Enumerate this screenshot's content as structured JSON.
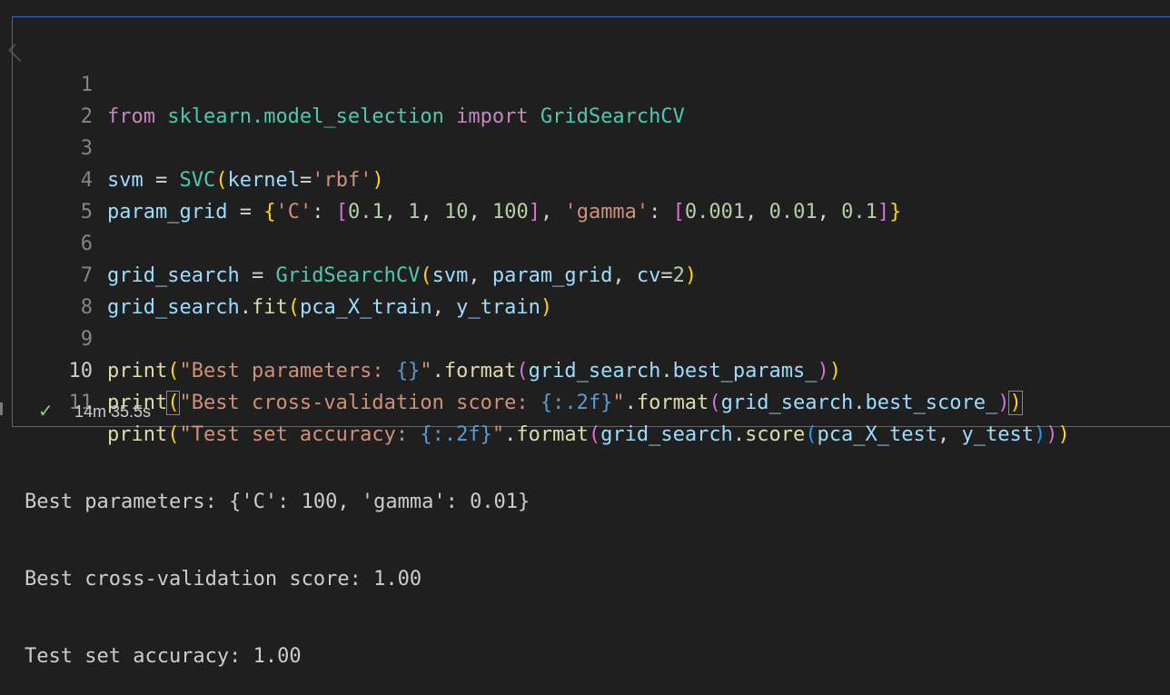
{
  "cell": {
    "lines": [
      {
        "n": "1"
      },
      {
        "n": "2"
      },
      {
        "n": "3"
      },
      {
        "n": "4"
      },
      {
        "n": "5"
      },
      {
        "n": "6"
      },
      {
        "n": "7"
      },
      {
        "n": "8"
      },
      {
        "n": "9"
      },
      {
        "n": "10"
      },
      {
        "n": "11"
      }
    ],
    "code": {
      "l1": {
        "from": "from",
        "mod": "sklearn.model_selection",
        "import": "import",
        "cls": "GridSearchCV"
      },
      "l3": {
        "var": "svm",
        "eq": " = ",
        "cls": "SVC",
        "po": "(",
        "arg": "kernel",
        "eq2": "=",
        "str": "'rbf'",
        "pc": ")"
      },
      "l4": {
        "var": "param_grid",
        "eq": " = ",
        "bo": "{",
        "k1": "'C'",
        "c1": ": ",
        "lo1": "[",
        "n1": "0.1",
        "s1": ", ",
        "n2": "1",
        "s2": ", ",
        "n3": "10",
        "s3": ", ",
        "n4": "100",
        "lc1": "]",
        "s4": ", ",
        "k2": "'gamma'",
        "c2": ": ",
        "lo2": "[",
        "n5": "0.001",
        "s5": ", ",
        "n6": "0.01",
        "s6": ", ",
        "n7": "0.1",
        "lc2": "]",
        "bc": "}"
      },
      "l6": {
        "var": "grid_search",
        "eq": " = ",
        "cls": "GridSearchCV",
        "po": "(",
        "a1": "svm",
        "s1": ", ",
        "a2": "param_grid",
        "s2": ", ",
        "a3": "cv",
        "eq2": "=",
        "n": "2",
        "pc": ")"
      },
      "l7": {
        "var": "grid_search",
        "dot": ".",
        "fn": "fit",
        "po": "(",
        "a1": "pca_X_train",
        "s1": ", ",
        "a2": "y_train",
        "pc": ")"
      },
      "l9": {
        "fn": "print",
        "po": "(",
        "str1": "\"Best parameters: ",
        "fmt": "{}",
        "str2": "\"",
        "dot": ".",
        "fmtfn": "format",
        "po2": "(",
        "a1": "grid_search",
        "dot2": ".",
        "a2": "best_params_",
        "pc2": ")",
        "pc": ")"
      },
      "l10": {
        "fn": "print",
        "po": "(",
        "str1": "\"Best cross-validation score: ",
        "fmt": "{:.2f}",
        "str2": "\"",
        "dot": ".",
        "fmtfn": "format",
        "po2": "(",
        "a1": "grid_search",
        "dot2": ".",
        "a2": "best_score_",
        "pc2": ")",
        "pc": ")"
      },
      "l11": {
        "fn": "print",
        "po": "(",
        "str1": "\"Test set accuracy: ",
        "fmt": "{:.2f}",
        "str2": "\"",
        "dot": ".",
        "fmtfn": "format",
        "po2": "(",
        "a1": "grid_search",
        "dot2": ".",
        "fn2": "score",
        "po3": "(",
        "a2": "pca_X_test",
        "s1": ", ",
        "a3": "y_test",
        "pc3": ")",
        "pc2": ")",
        "pc": ")"
      }
    },
    "status": {
      "icon": "check-icon",
      "duration": "14m 35.5s"
    }
  },
  "output": [
    "Best parameters: {'C': 100, 'gamma': 0.01}",
    "Best cross-validation score: 1.00",
    "Test set accuracy: 1.00"
  ],
  "colors": {
    "cell_border": "#2b6cc4",
    "background": "#1f1f1f",
    "success_check": "#89d185"
  }
}
